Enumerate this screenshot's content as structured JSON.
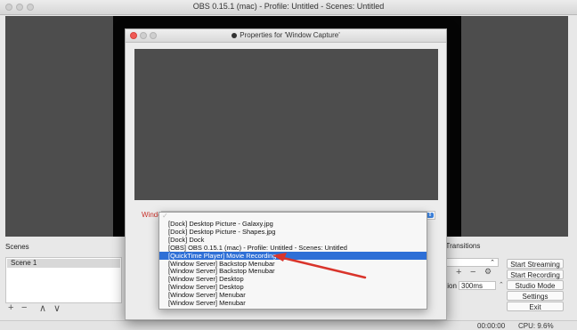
{
  "window": {
    "title": "OBS 0.15.1 (mac) - Profile: Untitled - Scenes: Untitled"
  },
  "scenes": {
    "label": "Scenes",
    "items": [
      "Scene 1"
    ],
    "controls": [
      "+",
      "−",
      "∧",
      "∨"
    ]
  },
  "sources": {
    "controls": [
      "+",
      "−"
    ]
  },
  "transitions": {
    "label": "e Transitions",
    "select_value": "e",
    "duration_label": "tion",
    "duration_value": "300ms",
    "controls": [
      "+",
      "−",
      "⚙"
    ]
  },
  "controls": {
    "start_streaming": "Start Streaming",
    "start_recording": "Start Recording",
    "studio_mode": "Studio Mode",
    "settings": "Settings",
    "exit": "Exit"
  },
  "status": {
    "time": "00:00:00",
    "cpu": "CPU: 9.6%"
  },
  "dialog": {
    "title": "Properties for 'Window Capture'",
    "window_label": "Window",
    "dropdown_items": [
      "[Dock] Desktop Picture - Galaxy.jpg",
      "[Dock] Desktop Picture - Shapes.jpg",
      "[Dock] Dock",
      "[OBS] OBS 0.15.1 (mac) - Profile: Untitled - Scenes: Untitled",
      "[QuickTime Player] Movie Recording",
      "[Window Server] Backstop Menubar",
      "[Window Server] Backstop Menubar",
      "[Window Server] Desktop",
      "[Window Server] Desktop",
      "[Window Server] Menubar",
      "[Window Server] Menubar"
    ],
    "selected_index": 4
  },
  "colors": {
    "selection": "#2e6fd6",
    "arrow": "#d9342b",
    "preview": "#4d4d4d"
  }
}
